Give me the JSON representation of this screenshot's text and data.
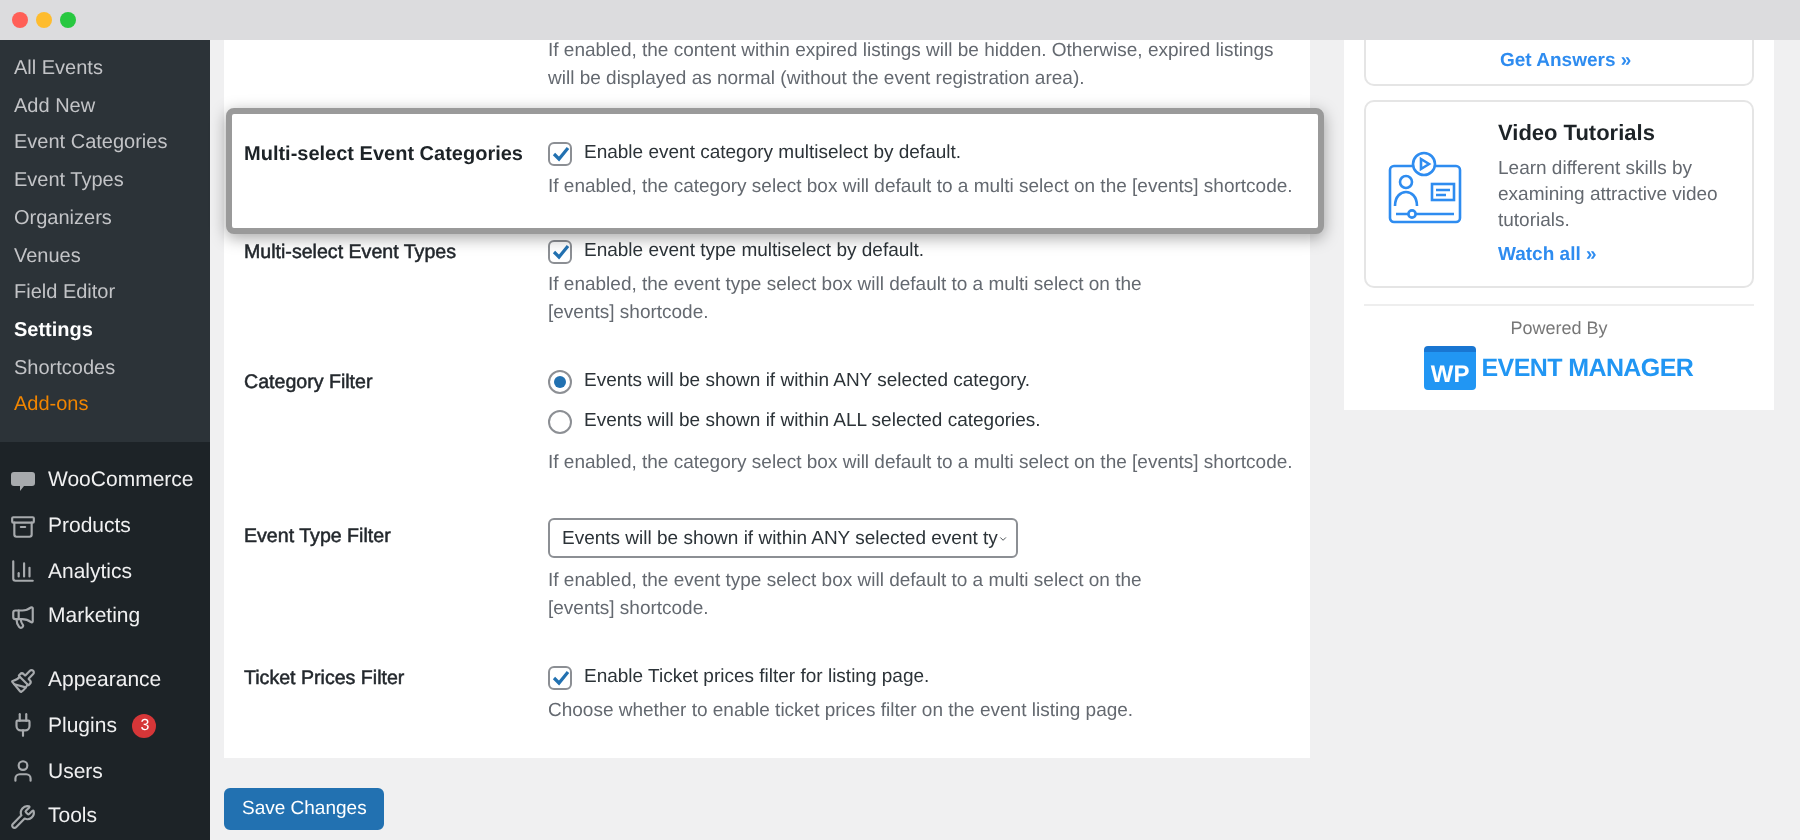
{
  "sidebar": {
    "submenu": [
      {
        "label": "All Events",
        "kind": "link",
        "selected": false
      },
      {
        "label": "Add New",
        "kind": "link",
        "selected": false
      },
      {
        "label": "Event Categories",
        "kind": "link",
        "selected": false
      },
      {
        "label": "Event Types",
        "kind": "link",
        "selected": false
      },
      {
        "label": "Organizers",
        "kind": "link",
        "selected": false
      },
      {
        "label": "Venues",
        "kind": "link",
        "selected": false
      },
      {
        "label": "Field Editor",
        "kind": "link",
        "selected": false
      },
      {
        "label": "Settings",
        "kind": "link",
        "selected": true
      },
      {
        "label": "Shortcodes",
        "kind": "link",
        "selected": false
      },
      {
        "label": "Add-ons",
        "kind": "addon",
        "selected": false
      }
    ],
    "menu_groups": [
      {
        "items": [
          {
            "label": "WooCommerce"
          },
          {
            "label": "Products"
          },
          {
            "label": "Analytics"
          },
          {
            "label": "Marketing"
          }
        ]
      },
      {
        "items": [
          {
            "label": "Appearance"
          },
          {
            "label": "Plugins",
            "badge": "3"
          },
          {
            "label": "Users"
          },
          {
            "label": "Tools"
          }
        ]
      }
    ]
  },
  "settings": {
    "rows": [
      {
        "kind": "note",
        "description": "If enabled, the content within expired listings will be hidden. Otherwise, expired listings will be displayed as normal (without the event registration area)."
      },
      {
        "kind": "checkbox",
        "highlighted": true,
        "label": "Multi-select Event Categories",
        "option": "Enable event category multiselect by default.",
        "checked": true,
        "description": "If enabled, the category select box will default to a multi select on the [events] shortcode."
      },
      {
        "kind": "checkbox",
        "highlighted": false,
        "label": "Multi-select Event Types",
        "option": "Enable event type multiselect by default.",
        "checked": true,
        "description": "If enabled, the event type select box will default to a multi select on the [events] shortcode."
      },
      {
        "kind": "radio",
        "highlighted": false,
        "label": "Category Filter",
        "options": [
          {
            "label": "Events will be shown if within ANY selected category.",
            "selected": true
          },
          {
            "label": "Events will be shown if within ALL selected categories.",
            "selected": false
          }
        ],
        "description": "If enabled, the category select box will default to a multi select on the [events] shortcode."
      },
      {
        "kind": "select",
        "highlighted": false,
        "label": "Event Type Filter",
        "value": "Events will be shown if within ANY selected event ty",
        "description": "If enabled, the event type select box will default to a multi select on the [events] shortcode."
      },
      {
        "kind": "checkbox",
        "highlighted": false,
        "label": "Ticket Prices Filter",
        "option": "Enable Ticket prices filter for listing page.",
        "checked": true,
        "description": "Choose whether to enable ticket prices filter on the event listing page."
      }
    ],
    "save_button": "Save Changes"
  },
  "help": {
    "top_link": "Get Answers »",
    "video_card": {
      "title": "Video Tutorials",
      "description": "Learn different skills by examining attractive video tutorials.",
      "link": "Watch all »"
    },
    "powered_by": "Powered By",
    "logo": {
      "badge": "WP",
      "name": "EVENT MANAGER"
    }
  }
}
